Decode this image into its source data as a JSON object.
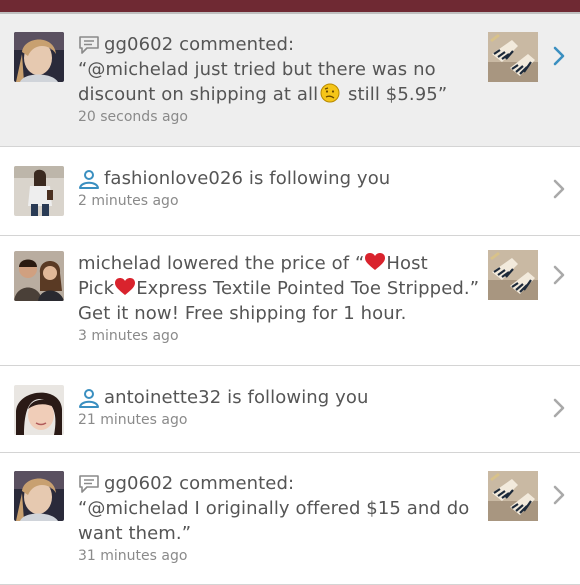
{
  "colors": {
    "top_bar": "#6f2933",
    "text": "#555555",
    "timestamp": "#8a8a8a",
    "highlight_bg": "#eeeeee",
    "accent_blue": "#3a8fc0",
    "heart_red": "#d9232d",
    "chevron_gray": "#a9a9a9"
  },
  "icons": {
    "comment": "speech-bubble-icon",
    "follow": "person-icon",
    "heart": "heart-icon",
    "emoji": "confused-face-icon",
    "chevron": "chevron-right-icon"
  },
  "notifications": [
    {
      "type": "comment",
      "highlight": true,
      "header": "gg0602 commented:",
      "body": [
        "“@michelad just tried but there was no",
        "discount on shipping at all",
        " still $5.95”"
      ],
      "time": "20 seconds ago",
      "has_thumb": true,
      "chevron_color": "#3a8fc0"
    },
    {
      "type": "follow",
      "highlight": false,
      "header": "fashionlove026 is following you",
      "time": "2 minutes ago",
      "has_thumb": false,
      "chevron_color": "#a9a9a9"
    },
    {
      "type": "price",
      "highlight": false,
      "lines": [
        "michelad lowered the price of “",
        "Host",
        "Pick",
        "Express Textile Pointed Toe Stripped.”",
        "Get it now! Free shipping for 1 hour."
      ],
      "time": "3 minutes ago",
      "has_thumb": true,
      "chevron_color": "#a9a9a9"
    },
    {
      "type": "follow",
      "highlight": false,
      "header": "antoinette32 is following you",
      "time": "21 minutes ago",
      "has_thumb": false,
      "chevron_color": "#a9a9a9"
    },
    {
      "type": "comment",
      "highlight": false,
      "header": "gg0602 commented:",
      "body": [
        "“@michelad I originally offered $15 and do",
        "want them.”"
      ],
      "time": "31 minutes ago",
      "has_thumb": true,
      "chevron_color": "#a9a9a9"
    }
  ]
}
